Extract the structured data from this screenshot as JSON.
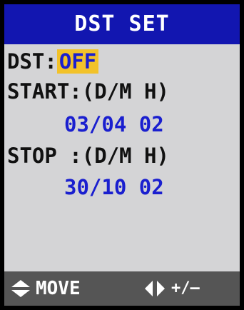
{
  "title": "DST SET",
  "dst": {
    "label": "DST:",
    "value": "OFF"
  },
  "start": {
    "label": "START:(D/M H)",
    "value": "03/04 02"
  },
  "stop": {
    "label": "STOP :(D/M H)",
    "value": "30/10 02"
  },
  "footer": {
    "move_icon": "up-down-arrows-icon",
    "move_label": "MOVE",
    "adjust_icon": "left-right-arrows-icon",
    "adjust_label": "+/–"
  },
  "colors": {
    "title_bg": "#1216b0",
    "screen_bg": "#d4d4d6",
    "highlight": "#f2c22a",
    "value_text": "#1a1fcf",
    "footer_bg": "#555555"
  }
}
